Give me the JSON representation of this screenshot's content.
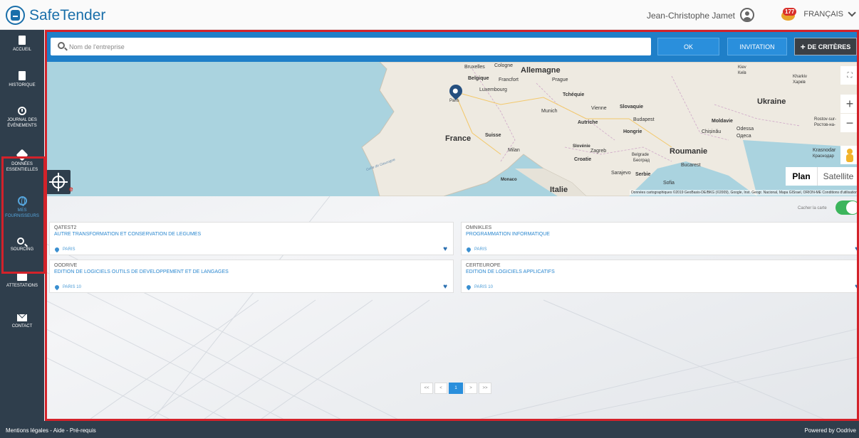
{
  "header": {
    "app_name": "SafeTender",
    "user_name": "Jean-Christophe Jamet",
    "notification_count": "177",
    "language": "FRANÇAIS"
  },
  "sidebar": {
    "items": [
      {
        "label": "ACCUEIL",
        "icon": "home-icon"
      },
      {
        "label": "HISTORIQUE",
        "icon": "history-icon"
      },
      {
        "label": "JOURNAL DES ÉVÉNEMENTS",
        "icon": "clock-icon"
      },
      {
        "label": "DONNÉES ESSENTIELLES",
        "icon": "cube-icon"
      },
      {
        "label": "MES FOURNISSEURS",
        "icon": "globe-icon",
        "active": true
      },
      {
        "label": "SOURCING",
        "icon": "search-icon"
      },
      {
        "label": "ATTESTATIONS",
        "icon": "folder-icon"
      },
      {
        "label": "CONTACT",
        "icon": "mail-icon"
      }
    ]
  },
  "search": {
    "placeholder": "Nom de l'entreprise",
    "ok_label": "OK",
    "invitation_label": "INVITATION",
    "criteria_label": "DE CRITÈRES"
  },
  "map": {
    "countries": [
      "Allemagne",
      "France",
      "Ukraine",
      "Roumanie",
      "Italie"
    ],
    "cities": [
      "Bruxelles",
      "Cologne",
      "Belgique",
      "Francfort",
      "Luxembourg",
      "Prague",
      "Tchéquie",
      "Munich",
      "Vienne",
      "Slovaquie",
      "Autriche",
      "Budapest",
      "Hongrie",
      "Moldavie",
      "Chișinău",
      "Odessa",
      "Одеса",
      "Suisse",
      "Milan",
      "Slovénie",
      "Zagreb",
      "Croatie",
      "Belgrade",
      "Београд",
      "Bucarest",
      "Sarajevo",
      "Serbie",
      "Sofia",
      "Monaco",
      "Kiev",
      "Київ",
      "Kharkiv",
      "Харків",
      "Rostov-sur-",
      "Ростов-на-",
      "Krasnodar",
      "Краснодар",
      "Paris"
    ],
    "sea_label": "Golfe de Gascogne",
    "plan_label": "Plan",
    "satellite_label": "Satellite",
    "attribution": "Données cartographiques ©2019 GeoBasis-DE/BKG (©2009), Google, Inst. Geogr. Nacional, Mapa GISrael, ORION-ME   Conditions d'utilisation",
    "google_fragment": "e"
  },
  "toggle": {
    "label": "Cacher la carte",
    "on": true
  },
  "suppliers": [
    {
      "name": "QATEST2",
      "activity": "AUTRE TRANSFORMATION ET CONSERVATION DE LEGUMES",
      "city": "PARIS"
    },
    {
      "name": "OMNIKLES",
      "activity": "PROGRAMMATION INFORMATIQUE",
      "city": "PARIS"
    },
    {
      "name": "OODRIVE",
      "activity": "EDITION DE LOGICIELS OUTILS DE DEVELOPPEMENT ET DE LANGAGES",
      "city": "PARIS 10"
    },
    {
      "name": "CERTEUROPE",
      "activity": "EDITION DE LOGICIELS APPLICATIFS",
      "city": "PARIS 10"
    }
  ],
  "pagination": {
    "first": "<<",
    "prev": "<",
    "current": "1",
    "next": ">",
    "last": ">>"
  },
  "footer": {
    "links": "Mentions légales - Aide - Pré-requis",
    "powered": "Powered by Oodrive"
  },
  "colors": {
    "brand": "#1a6faa",
    "sidebar_bg": "#2f3e4c",
    "search_bar_bg": "#1f7fc8",
    "highlight": "#d3222a",
    "toggle_on": "#3cb55c"
  }
}
